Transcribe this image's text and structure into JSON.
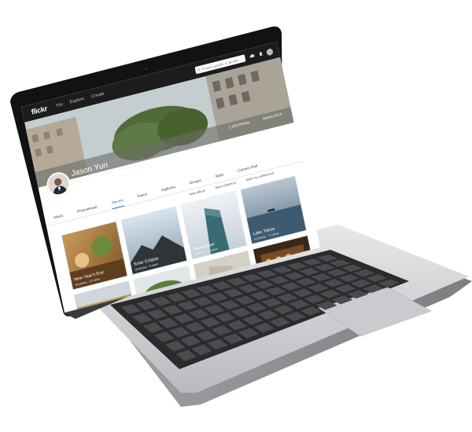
{
  "nav": {
    "logo": "flickr",
    "links": [
      "You",
      "Explore",
      "Create"
    ],
    "search_placeholder": "Photos, people, or groups"
  },
  "cover": {
    "photos_stat": "1,230 Photos",
    "joined_stat": "Joined 2014"
  },
  "profile": {
    "name": "Jason Yun",
    "username": "Jason J. Yun",
    "followers": "29 Followers",
    "following": "25 Following"
  },
  "tabs": [
    "About",
    "Photostream",
    "Albums",
    "Faves",
    "Galleries",
    "Groups",
    "Stats",
    "Camera Roll"
  ],
  "active_tab": "Albums",
  "actions": {
    "new_album": "New album",
    "new_collection": "New collection",
    "view_collections": "View my collections"
  },
  "albums": [
    {
      "title": "New Year's Eve",
      "meta": "48 photos · 21 views"
    },
    {
      "title": "Solar Eclipse",
      "meta": "16 photos · 8 views"
    },
    {
      "title": "Skyscraper",
      "meta": "8 photos · 13 views"
    },
    {
      "title": "Lake Tahoe",
      "meta": "53 photos · 71 views"
    },
    {
      "title": "",
      "meta": ""
    },
    {
      "title": "",
      "meta": ""
    },
    {
      "title": "",
      "meta": ""
    },
    {
      "title": "",
      "meta": ""
    }
  ],
  "colors": {
    "nav_bg": "#1c1c1c",
    "accent": "#1e7ad6"
  }
}
